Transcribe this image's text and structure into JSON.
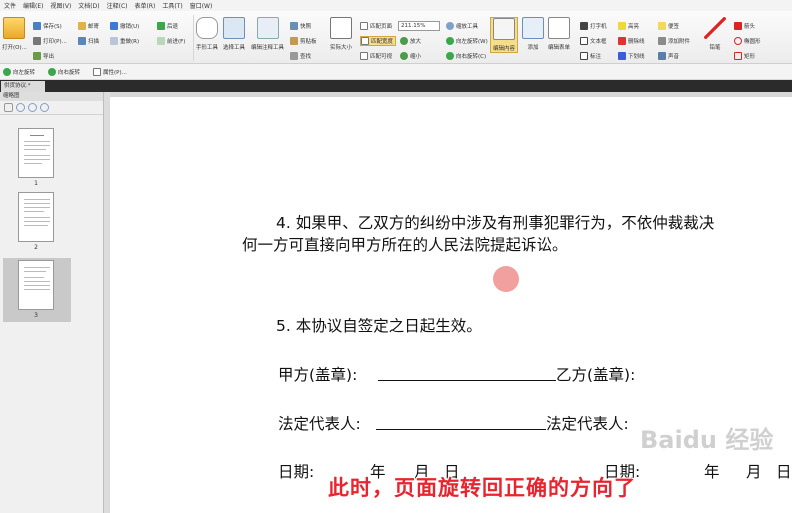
{
  "menu": [
    "文件",
    "编辑(E)",
    "视图(V)",
    "文档(D)",
    "注释(C)",
    "表单(R)",
    "工具(T)",
    "窗口(W)"
  ],
  "ribbon": {
    "open": "打开(O)...",
    "save": "保存(S)",
    "print": "打印(P)...",
    "export": "导出",
    "email": "邮寄",
    "scan": "扫描",
    "undo": "撤销(U)",
    "redo": "重做(R)",
    "back": "后退",
    "forward": "前进(F)",
    "prev_view": "上一视图",
    "next_view": "下一视图",
    "hand": "手形工具",
    "select_text": "选择工具",
    "select_annot": "编辑注释工具",
    "snapshot": "快照",
    "clipboard": "剪贴板",
    "find": "查找",
    "actual_size": "实际大小",
    "fit_page": "匹配页面",
    "fit_width": "匹配宽度",
    "fit_visible": "匹配可视",
    "zoom_value": "211.15%",
    "zoom_in": "放大",
    "zoom_out": "缩小",
    "zoom_tool": "缩放工具",
    "rotate_left": "向左旋转(W)",
    "rotate_right": "向右旋转(C)",
    "edit_content": "编辑内容",
    "add": "添加",
    "edit_form": "编辑表单",
    "typewriter": "打字机",
    "textbox": "文本框",
    "callout": "标注",
    "highlight": "高亮",
    "strikeout": "删除线",
    "underline": "下划线",
    "note": "便签",
    "attach_file": "添加附件",
    "sound": "声音",
    "pencil": "铅笔",
    "arrow": "箭头",
    "ellipse": "椭圆形",
    "rectangle": "矩形"
  },
  "quickbar": {
    "rotate_left": "向左旋转",
    "rotate_right": "向右旋转",
    "properties": "属性(P)..."
  },
  "tabs": {
    "doc_tab": "供货协议.*"
  },
  "sidebar": {
    "title": "缩略图",
    "pages": [
      "1",
      "2",
      "3"
    ]
  },
  "document": {
    "clause4_line1": "4. 如果甲、乙双方的纠纷中涉及有刑事犯罪行为，不依仲裁裁决",
    "clause4_line2": "何一方可直接向甲方所在的人民法院提起诉讼。",
    "clause5": "5. 本协议自签定之日起生效。",
    "party_a": "甲方(盖章):",
    "party_b": "乙方(盖章):",
    "rep_a": "法定代表人:",
    "rep_b": "法定代表人:",
    "date_a": "日期:",
    "date_b": "日期:",
    "year": "年",
    "month": "月",
    "day": "日"
  },
  "overlay": {
    "subtitle": "此时，页面旋转回正确的方向了",
    "watermark": "Baidu 经验"
  },
  "colors": {
    "subtitle": "#e8242f",
    "tabbar": "#2b2b2b"
  }
}
